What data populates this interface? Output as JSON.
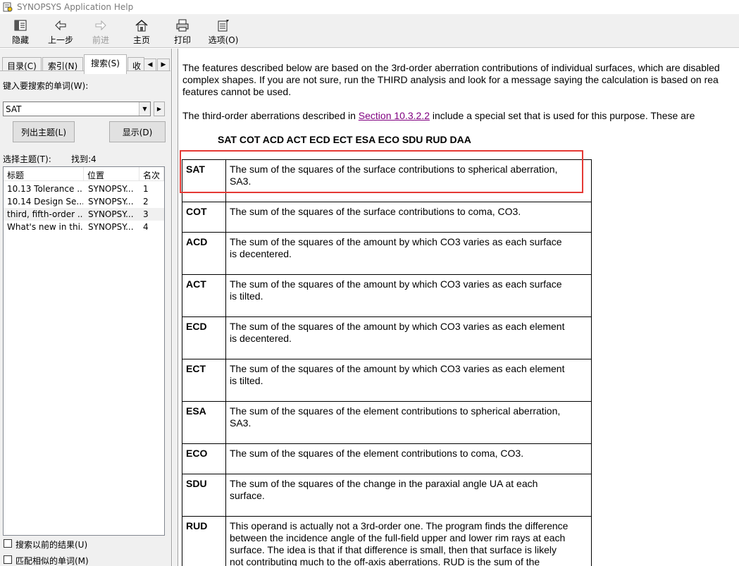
{
  "window": {
    "title": "SYNOPSYS Application Help"
  },
  "toolbar": {
    "items": [
      {
        "label": "隐藏",
        "icon": "hide-pane-icon",
        "enabled": true
      },
      {
        "label": "上一步",
        "icon": "back-arrow-icon",
        "enabled": true
      },
      {
        "label": "前进",
        "icon": "forward-arrow-icon",
        "enabled": false
      },
      {
        "label": "主页",
        "icon": "home-icon",
        "enabled": true
      },
      {
        "label": "打印",
        "icon": "printer-icon",
        "enabled": true
      },
      {
        "label": "选项(O)",
        "icon": "options-icon",
        "enabled": true
      }
    ]
  },
  "left": {
    "tabs": [
      "目录(C)",
      "索引(N)",
      "搜索(S)",
      "收"
    ],
    "active_tab": "搜索(S)",
    "search_label": "键入要搜索的单词(W):",
    "search_value": "SAT",
    "list_topics_button": "列出主题(L)",
    "display_button": "显示(D)",
    "select_topic_label": "选择主题(T):",
    "found_label": "找到:4",
    "columns": [
      "标题",
      "位置",
      "名次"
    ],
    "results": [
      {
        "title": "10.13 Tolerance ...",
        "location": "SYNOPSY...",
        "rank": "1"
      },
      {
        "title": "10.14 Design Se...",
        "location": "SYNOPSY...",
        "rank": "2"
      },
      {
        "title": "third, fifth-order ...",
        "location": "SYNOPSY...",
        "rank": "3"
      },
      {
        "title": "What's new in thi...",
        "location": "SYNOPSY...",
        "rank": "4"
      }
    ],
    "selected_result": 2,
    "search_previous_label": "搜索以前的结果(U)",
    "match_similar_label": "匹配相似的单词(M)"
  },
  "content": {
    "para1_line1": "The features described below are based on the 3rd-order aberration contributions of individual surfaces, which are disabled",
    "para1_line2": "complex shapes.  If you are not sure, run the THIRD analysis and look for a message saying the calculation is based on rea",
    "para1_line3": "features cannot be used.",
    "para2_pre": "The third-order aberrations described in ",
    "para2_link": "Section 10.3.2.2",
    "para2_post": " include a special set that is used for this purpose.  These are",
    "operand_list": "SAT COT ACD ACT ECD ECT ESA ECO SDU RUD DAA",
    "table": [
      {
        "name": "SAT",
        "line1": "The sum of the squares of the surface contributions to spherical aberration,",
        "line2": "SA3."
      },
      {
        "name": "COT",
        "line1": "The sum of the squares of the surface contributions to coma, CO3.",
        "line2": ""
      },
      {
        "name": "ACD",
        "line1": "The sum of the squares of the amount by which CO3 varies as each surface",
        "line2": "is decentered."
      },
      {
        "name": "ACT",
        "line1": "The sum of the squares of the amount by which CO3 varies as each surface",
        "line2": "is tilted."
      },
      {
        "name": "ECD",
        "line1": "The sum of the squares of the amount by which CO3 varies as each element",
        "line2": "is decentered."
      },
      {
        "name": "ECT",
        "line1": "The sum of the squares of the amount by which CO3 varies as each element",
        "line2": "is tilted."
      },
      {
        "name": "ESA",
        "line1": "The sum of the squares of the element contributions to spherical aberration,",
        "line2": "SA3."
      },
      {
        "name": "ECO",
        "line1": "The sum of the squares of the element contributions to coma, CO3.",
        "line2": ""
      },
      {
        "name": "SDU",
        "line1": "The sum of the squares of the change in the paraxial angle UA at each",
        "line2": "surface."
      },
      {
        "name": "RUD",
        "line1": "This operand is actually not a 3rd-order one.  The program finds the difference",
        "line2": "between the incidence angle of the full-field upper and lower rim rays at each",
        "line3": "surface.  The idea is that if that difference is small, then that surface is likely",
        "line4": "not contributing much to the off-axis aberrations.  RUD is the sum of the"
      }
    ],
    "highlight_color": "#e53935"
  }
}
